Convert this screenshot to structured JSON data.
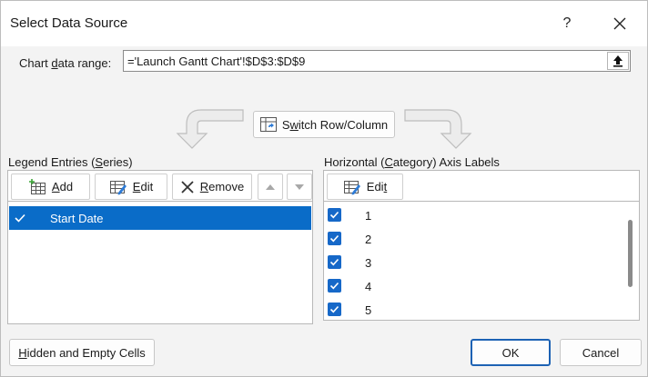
{
  "window": {
    "title": "Select Data Source",
    "help_glyph": "?",
    "close_icon": "close-icon"
  },
  "range": {
    "label_pre": "Chart ",
    "label_u": "d",
    "label_post": "ata range:",
    "value": "='Launch Gantt Chart'!$D$3:$D$9",
    "collapse_icon": "collapse-dialog-icon"
  },
  "switch": {
    "pre": "S",
    "u": "w",
    "post": "itch Row/Column"
  },
  "legend": {
    "label_pre": "Legend Entries (",
    "label_u": "S",
    "label_post": "eries)",
    "add": {
      "pre": "",
      "u": "A",
      "post": "dd"
    },
    "edit": {
      "pre": "",
      "u": "E",
      "post": "dit"
    },
    "remove": {
      "pre": "",
      "u": "R",
      "post": "emove"
    },
    "series": [
      {
        "name": "Start Date",
        "checked": true
      }
    ]
  },
  "axis": {
    "label_pre": "Horizontal (",
    "label_u": "C",
    "label_post": "ategory) Axis Labels",
    "edit": {
      "pre": "Edi",
      "u": "t",
      "post": ""
    },
    "items": [
      {
        "label": "1",
        "checked": true
      },
      {
        "label": "2",
        "checked": true
      },
      {
        "label": "3",
        "checked": true
      },
      {
        "label": "4",
        "checked": true
      },
      {
        "label": "5",
        "checked": true
      }
    ]
  },
  "footer": {
    "hidden": {
      "pre": "",
      "u": "H",
      "post": "idden and Empty Cells"
    },
    "ok": "OK",
    "cancel": "Cancel"
  },
  "colors": {
    "selection": "#0a6cc8",
    "checkbox": "#1668c8",
    "default_button_border": "#1d62b4"
  }
}
